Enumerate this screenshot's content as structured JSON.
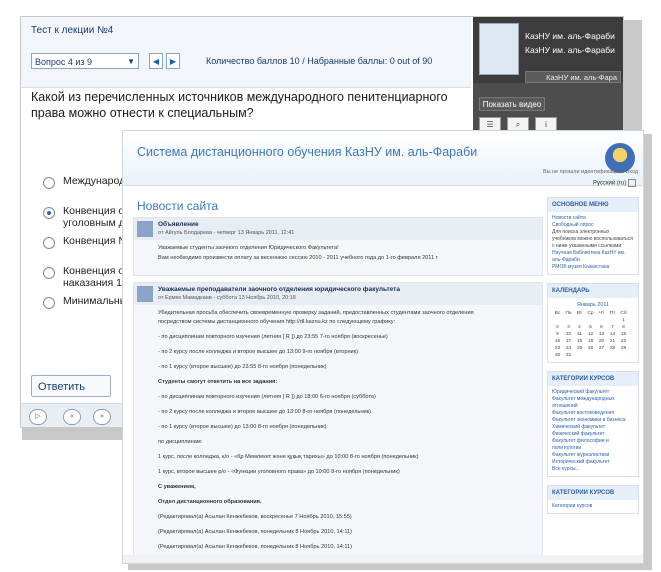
{
  "back_window": {
    "test_title": "Тест к лекции №4",
    "question_select": "Вопрос 4 из 9",
    "nav_prev": "◀",
    "nav_next": "▶",
    "score_text": "Количество баллов 10 / Набранные баллы: 0 out of 90",
    "question": "Какой из перечисленных источников международного пенитенциарного права можно отнести к специальным?",
    "answers": [
      {
        "text": "Международн",
        "selected": false
      },
      {
        "text": "Конвенция о п уголовным дел",
        "selected": true
      },
      {
        "text": "Конвенция №",
        "selected": false
      },
      {
        "text": "Конвенция о п наказания 199",
        "selected": false
      },
      {
        "text": "Минимальные",
        "selected": false
      }
    ],
    "answer_button": "Ответить",
    "uni_name_1": "КазНУ им. аль-Фараби",
    "uni_name_2": "КазНУ им. аль-Фараби",
    "uni_button": "КазНУ им. аль-Фара",
    "video_button": "Показать видео",
    "tool_icons": [
      "list-icon",
      "search-icon",
      "info-icon"
    ]
  },
  "front_window": {
    "site_title": "Система дистанционного обучения КазНУ им. аль-Фараби",
    "login_text": "Вы не прошли идентификацию. Вход",
    "language": "Русский (ru)",
    "news_title": "Новости сайта",
    "post1": {
      "title": "Объявление",
      "meta": "от Айгуль Болдарева - четверг 13 Январь 2011, 12:41",
      "lines": [
        "Уважаемые студенты заочного отделения Юридического Факультета!",
        "Вам необходимо произвести оплату за весеннюю сессию 2010 - 2011 учебного года до 1-го февраля 2011 г"
      ]
    },
    "post2": {
      "title": "Уважаемые преподаватели заочного отделения юридического факультета",
      "meta": "от Ермек Мамадкаев - суббота 13 Ноябрь 2010, 20:18",
      "lines": [
        "Убедительная просьба обеспечить своевременную проверку заданий, предоставленных студентами заочного отделения",
        "посредством системы дистанционного обучения http://dl.kaznu.kz по следующему графику:",
        "- по дисциплинам повторного изучения (летняя [ R ]) до 23:55 7-го ноября (воскресенье)",
        "- по 2 курсу после колледжа и второе высшее до 13:00 9-го ноября (вторник)",
        "- по 1 курсу (второе высшее) до 23:55 8-го ноября (понедельник)",
        "Студенты смогут ответить на все задания:",
        "- по дисциплинам повторного изучения (летняя [ R ]) до 18:00 6-го ноября (суббота)",
        "- по 2 курсу после колледжа и второе высшее до 13:00 8-го ноября (понедельник)",
        "- по 1 курсу (второе высшее) до 13:00 8-го ноября (понедельник)",
        "по дисциплинам:",
        "1 курс, после колледжа, к/о - «Қр Мемлекет және құқық тарихы» до 10:00 8-го ноября (понедельник)",
        "1 курс, второе высшее р/о - «Функции уголовного права» до 10:00 8-го ноября (понедельник)",
        "С уважением,",
        "Отдел дистанционного образования.",
        "(Редактировал(а) Асылан Кенжебеков, воскресенье 7 Ноябрь 2010, 15:55)",
        "(Редактировал(а) Асылан Кенжебеков, понедельник 8 Ноябрь 2010, 14:11)",
        "(Редактировал(а) Асылан Кенжебеков, понедельник 8 Ноябрь 2010, 14:11)"
      ]
    },
    "side_blocks": {
      "main_menu": {
        "title": "ОСНОВНОЕ МЕНЮ",
        "items": [
          "Новости сайта",
          "Свободный опрос",
          "Для поиска электронных учебников можно воспользоваться с ниже указанными ссылками:",
          "Научная Библиотека КазНУ им. аль-Фараби",
          "РМОБ музея Казахстана"
        ]
      },
      "calendar": {
        "title": "КАЛЕНДАРЬ",
        "month": "Январь 2011",
        "days": [
          "Вс",
          "Пн",
          "Вт",
          "Ср",
          "Чт",
          "Пт",
          "Сб"
        ],
        "dates": [
          "",
          "",
          "",
          "",
          "",
          "",
          "1",
          "2",
          "3",
          "4",
          "5",
          "6",
          "7",
          "8",
          "9",
          "10",
          "11",
          "12",
          "13",
          "14",
          "15",
          "16",
          "17",
          "18",
          "19",
          "20",
          "21",
          "22",
          "23",
          "24",
          "25",
          "26",
          "27",
          "28",
          "29",
          "30",
          "31",
          "",
          "",
          "",
          "",
          ""
        ]
      },
      "categories": {
        "title": "КАТЕГОРИИ КУРСОВ",
        "items": [
          "Юридический факультет",
          "Факультет международных отношений",
          "Факультет востоковедения",
          "Факультет экономики и бизнеса",
          "Химический факультет",
          "Физический факультет",
          "Факультет философии и политологии",
          "Факультет журналистики",
          "Исторический факультет",
          "Все курсы..."
        ]
      },
      "categories2": {
        "title": "КАТЕГОРИИ КУРСОВ",
        "items": [
          "Категории курсов"
        ]
      }
    }
  }
}
